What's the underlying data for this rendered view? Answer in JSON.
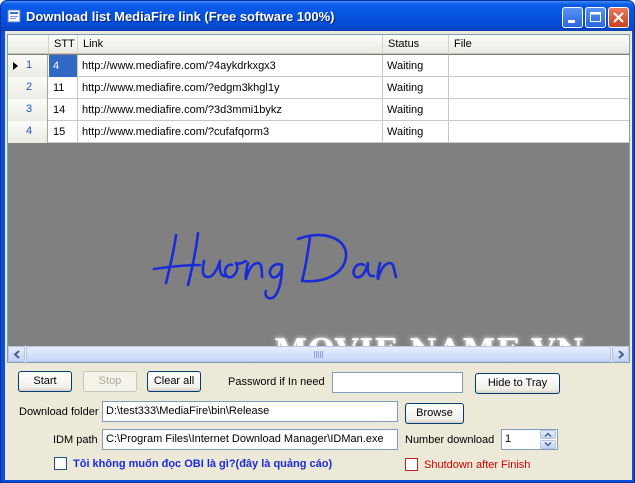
{
  "window": {
    "title": "Download list MediaFire link (Free software 100%)"
  },
  "grid": {
    "columns": [
      "STT",
      "Link",
      "Status",
      "File"
    ],
    "rows": [
      {
        "row_number": "1",
        "stt": "4",
        "link": "http://www.mediafire.com/?4aykdrkxgx3",
        "status": "Waiting",
        "file": "",
        "current": true
      },
      {
        "row_number": "2",
        "stt": "11",
        "link": "http://www.mediafire.com/?edgm3khgl1y",
        "status": "Waiting",
        "file": "",
        "current": false
      },
      {
        "row_number": "3",
        "stt": "14",
        "link": "http://www.mediafire.com/?3d3mmi1bykz",
        "status": "Waiting",
        "file": "",
        "current": false
      },
      {
        "row_number": "4",
        "stt": "15",
        "link": "http://www.mediafire.com/?cufafqorm3",
        "status": "Waiting",
        "file": "",
        "current": false
      }
    ]
  },
  "overlay": {
    "handwriting": "Huong Dan",
    "watermark": "MOVIE.NAME.VN"
  },
  "controls": {
    "start_label": "Start",
    "stop_label": "Stop",
    "clear_all_label": "Clear all",
    "password_label": "Password if In need",
    "password_value": "",
    "hide_to_tray_label": "Hide to Tray",
    "download_folder_label": "Download folder",
    "download_folder_value": "D:\\test333\\MediaFire\\bin\\Release",
    "browse_label": "Browse",
    "idm_path_label": "IDM path",
    "idm_path_value": "C:\\Program Files\\Internet Download Manager\\IDMan.exe",
    "number_download_label": "Number download",
    "number_download_value": "1",
    "obi_checkbox_label": "Tôi không muốn đọc OBI là gì?(đây là quảng cáo)",
    "obi_checked": false,
    "shutdown_label": "Shutdown after Finish",
    "shutdown_checked": false
  },
  "colors": {
    "titlebar": "#0553e1",
    "selection": "#316ac5",
    "handwriting": "#1a2bd8",
    "obi_label": "#1a2bd8",
    "shutdown_label": "#d40000"
  }
}
